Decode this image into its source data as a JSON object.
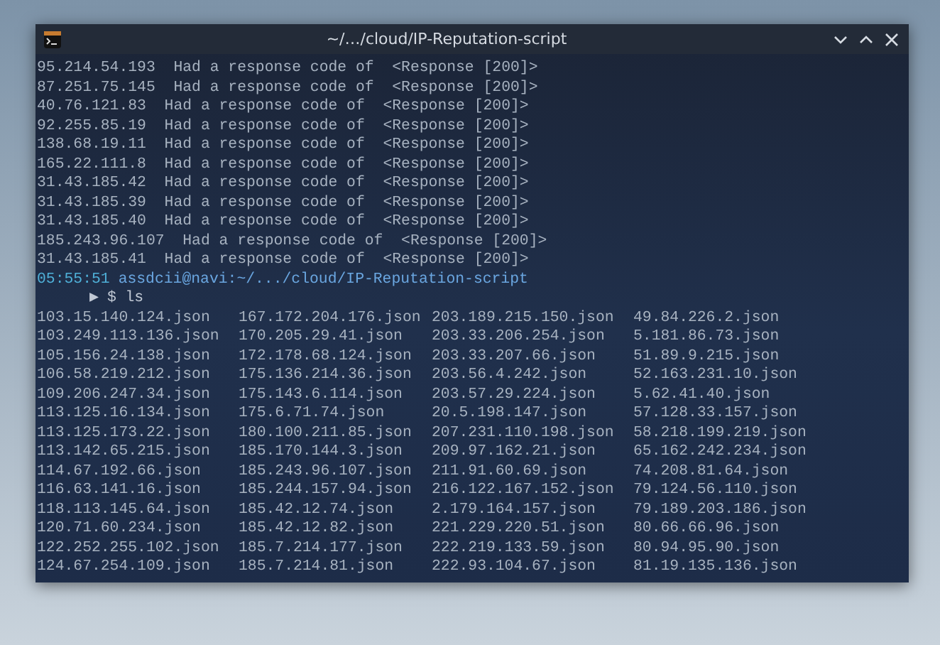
{
  "window": {
    "title": "~/…/cloud/IP-Reputation-script"
  },
  "output_lines": [
    "95.214.54.193  Had a response code of  <Response [200]>",
    "87.251.75.145  Had a response code of  <Response [200]>",
    "40.76.121.83  Had a response code of  <Response [200]>",
    "92.255.85.19  Had a response code of  <Response [200]>",
    "138.68.19.11  Had a response code of  <Response [200]>",
    "165.22.111.8  Had a response code of  <Response [200]>",
    "31.43.185.42  Had a response code of  <Response [200]>",
    "31.43.185.39  Had a response code of  <Response [200]>",
    "31.43.185.40  Had a response code of  <Response [200]>",
    "185.243.96.107  Had a response code of  <Response [200]>",
    "31.43.185.41  Had a response code of  <Response [200]>"
  ],
  "prompt": {
    "time": "05:55:51",
    "location": "assdcii@navi:~/.../cloud/IP-Reputation-script",
    "arrow": "▶",
    "command": "$ ls"
  },
  "listing": [
    [
      "103.15.140.124.json",
      "103.249.113.136.json",
      "105.156.24.138.json",
      "106.58.219.212.json",
      "109.206.247.34.json",
      "113.125.16.134.json",
      "113.125.173.22.json",
      "113.142.65.215.json",
      "114.67.192.66.json",
      "116.63.141.16.json",
      "118.113.145.64.json",
      "120.71.60.234.json",
      "122.252.255.102.json",
      "124.67.254.109.json"
    ],
    [
      "167.172.204.176.json",
      "170.205.29.41.json",
      "172.178.68.124.json",
      "175.136.214.36.json",
      "175.143.6.114.json",
      "175.6.71.74.json",
      "180.100.211.85.json",
      "185.170.144.3.json",
      "185.243.96.107.json",
      "185.244.157.94.json",
      "185.42.12.74.json",
      "185.42.12.82.json",
      "185.7.214.177.json",
      "185.7.214.81.json"
    ],
    [
      "203.189.215.150.json",
      "203.33.206.254.json",
      "203.33.207.66.json",
      "203.56.4.242.json",
      "203.57.29.224.json",
      "20.5.198.147.json",
      "207.231.110.198.json",
      "209.97.162.21.json",
      "211.91.60.69.json",
      "216.122.167.152.json",
      "2.179.164.157.json",
      "221.229.220.51.json",
      "222.219.133.59.json",
      "222.93.104.67.json"
    ],
    [
      "49.84.226.2.json",
      "5.181.86.73.json",
      "51.89.9.215.json",
      "52.163.231.10.json",
      "5.62.41.40.json",
      "57.128.33.157.json",
      "58.218.199.219.json",
      "65.162.242.234.json",
      "74.208.81.64.json",
      "79.124.56.110.json",
      "79.189.203.186.json",
      "80.66.66.96.json",
      "80.94.95.90.json",
      "81.19.135.136.json"
    ]
  ]
}
